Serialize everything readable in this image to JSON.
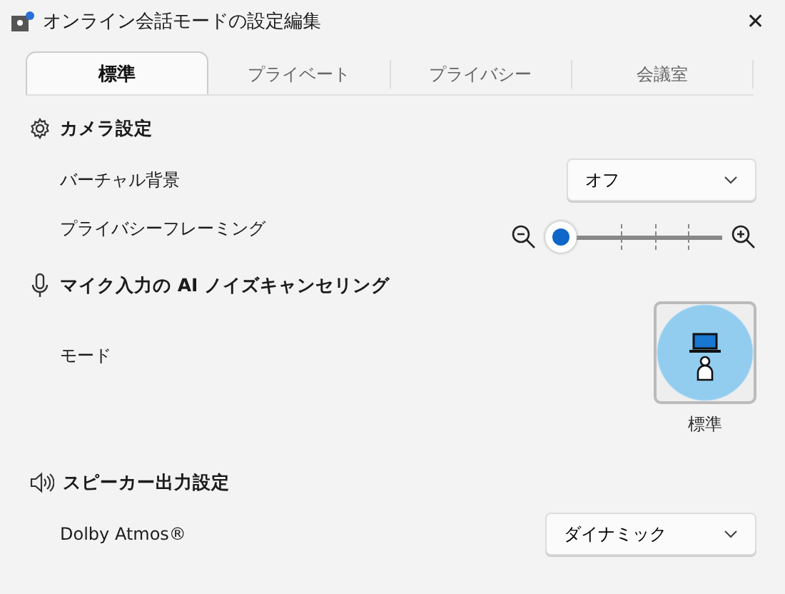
{
  "window": {
    "title": "オンライン会話モードの設定編集",
    "close": "✕"
  },
  "tabs": [
    {
      "label": "標準",
      "selected": true
    },
    {
      "label": "プライベート",
      "selected": false
    },
    {
      "label": "プライバシー",
      "selected": false
    },
    {
      "label": "会議室",
      "selected": false
    }
  ],
  "sections": [
    {
      "kind": "camera",
      "title": "カメラ設定",
      "rows": [
        {
          "kind": "dropdown",
          "label": "バーチャル背景",
          "value": "オフ"
        },
        {
          "kind": "slider",
          "label": "プライバシーフレーミング"
        }
      ]
    },
    {
      "kind": "mic",
      "title": "マイク入力の AI ノイズキャンセリング",
      "rows": [
        {
          "kind": "mode",
          "label": "モード",
          "option": "標準",
          "selected": true
        }
      ]
    },
    {
      "kind": "speaker",
      "title": "スピーカー出力設定",
      "rows": [
        {
          "kind": "dropdown",
          "label": "Dolby Atmos®",
          "value": "ダイナミック"
        }
      ]
    }
  ]
}
